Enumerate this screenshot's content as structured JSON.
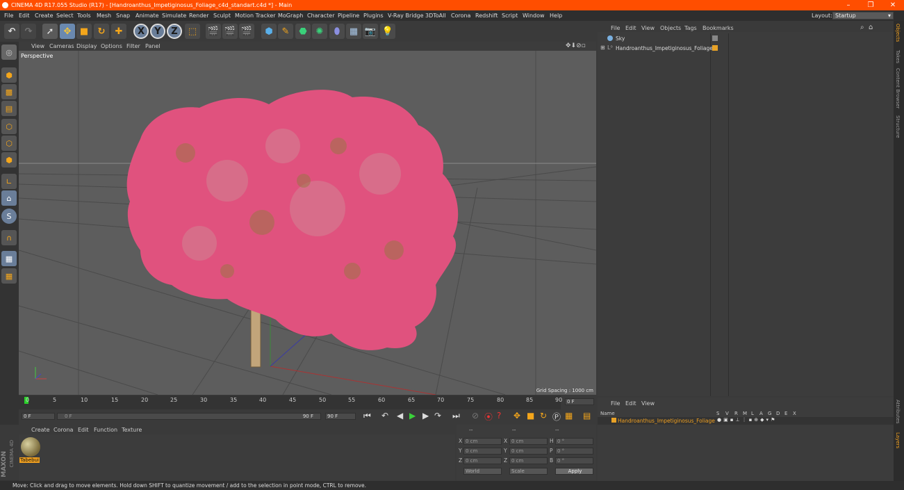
{
  "window": {
    "title": "CINEMA 4D R17.055 Studio (R17) - [Handroanthus_Impetiginosus_Foliage_c4d_standart.c4d *] - Main",
    "controls": [
      "–",
      "❐",
      "✕"
    ]
  },
  "menubar": {
    "items": [
      "File",
      "Edit",
      "Create",
      "Select",
      "Tools",
      "Mesh",
      "Snap",
      "Animate",
      "Simulate",
      "Render",
      "Sculpt",
      "Motion Tracker",
      "MoGraph",
      "Character",
      "Pipeline",
      "Plugins",
      "V-Ray Bridge",
      "3DToAll",
      "Corona",
      "Redshift",
      "Script",
      "Window",
      "Help"
    ],
    "layout_label": "Layout:",
    "layout_value": "Startup"
  },
  "toolbar": {
    "axis_x": "X",
    "axis_y": "Y",
    "axis_z": "Z"
  },
  "viewport": {
    "menu": [
      "View",
      "Cameras",
      "Display",
      "Options",
      "Filter",
      "Panel"
    ],
    "label": "Perspective",
    "grid_spacing": "Grid Spacing : 1000 cm"
  },
  "timeline": {
    "ticks": [
      "0",
      "5",
      "10",
      "15",
      "20",
      "25",
      "30",
      "35",
      "40",
      "45",
      "50",
      "55",
      "60",
      "65",
      "70",
      "75",
      "80",
      "85",
      "90"
    ],
    "current_frame": "0 F"
  },
  "playbar": {
    "start": "0 F",
    "range_start": "0 F",
    "range_end": "90 F",
    "end": "90 F"
  },
  "materials": {
    "menu": [
      "Create",
      "Corona",
      "Edit",
      "Function",
      "Texture"
    ],
    "items": [
      {
        "name": "Tabebui"
      }
    ]
  },
  "coordinates": {
    "headers": [
      "--",
      "--",
      "--"
    ],
    "rows": [
      {
        "a": "X",
        "av": "0 cm",
        "b": "X",
        "bv": "0 cm",
        "c": "H",
        "cv": "0 °"
      },
      {
        "a": "Y",
        "av": "0 cm",
        "b": "Y",
        "bv": "0 cm",
        "c": "P",
        "cv": "0 °"
      },
      {
        "a": "Z",
        "av": "0 cm",
        "b": "Z",
        "bv": "0 cm",
        "c": "B",
        "cv": "0 °"
      }
    ],
    "space": "World",
    "mode": "Scale",
    "apply": "Apply"
  },
  "objects_panel": {
    "menu": [
      "File",
      "Edit",
      "View",
      "Objects",
      "Tags",
      "Bookmarks"
    ],
    "objects": [
      {
        "name": "Sky"
      },
      {
        "name": "Handroanthus_Impetiginosus_Foliage"
      }
    ]
  },
  "layers_panel": {
    "menu": [
      "File",
      "Edit",
      "View"
    ],
    "header_name": "Name",
    "header_cols": [
      "S",
      "V",
      "R",
      "M",
      "L",
      "A",
      "G",
      "D",
      "E",
      "X"
    ],
    "layers": [
      {
        "name": "Handroanthus_Impetiginosus_Foliage",
        "color": "#e8a227"
      }
    ]
  },
  "right_tabs": [
    "Objects",
    "Takes",
    "Content Browser",
    "Structure",
    "Attributes",
    "Layers"
  ],
  "brand": {
    "line1": "MAXON",
    "line2": "CINEMA 4D"
  },
  "status": "Move: Click and drag to move elements. Hold down SHIFT to quantize movement / add to the selection in point mode, CTRL to remove.",
  "colors": {
    "accent": "#ff4e00",
    "foliage": "#e0527e",
    "trunk": "#c2a57a",
    "highlight": "#f0a020"
  }
}
